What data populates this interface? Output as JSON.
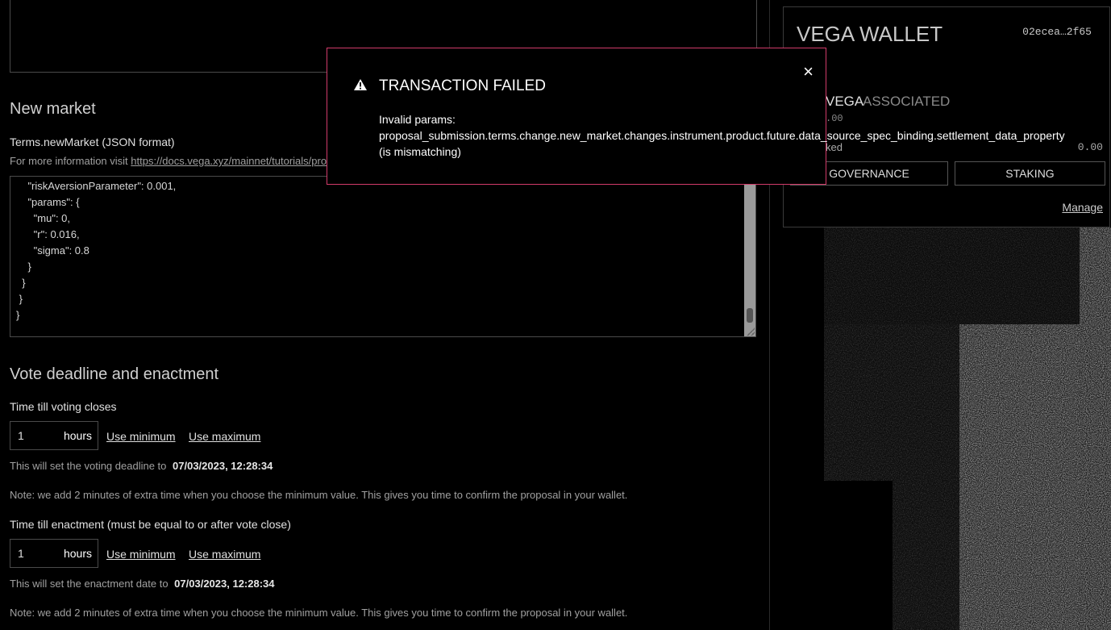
{
  "new_market": {
    "heading": "New market",
    "terms_label": "Terms.newMarket (JSON format)",
    "info_prefix": "For more information visit",
    "info_link": "https://docs.vega.xyz/mainnet/tutorials/pro",
    "json_lines": [
      "    \"riskAversionParameter\": 0.001,",
      "    \"params\": {",
      "      \"mu\": 0,",
      "      \"r\": 0.016,",
      "      \"sigma\": 0.8",
      "    }",
      "  }",
      " }",
      "}"
    ]
  },
  "vote": {
    "heading": "Vote deadline and enactment",
    "voting": {
      "label": "Time till voting closes",
      "value": "1",
      "unit": "hours",
      "use_min": "Use minimum",
      "use_max": "Use maximum",
      "deadline_text": "This will set the voting deadline to",
      "deadline_value": "07/03/2023, 12:28:34",
      "note": "Note: we add 2 minutes of extra time when you choose the minimum value. This gives you time to confirm the proposal in your wallet."
    },
    "enactment": {
      "label": "Time till enactment (must be equal to or after vote close)",
      "value": "1",
      "unit": "hours",
      "use_min": "Use minimum",
      "use_max": "Use maximum",
      "date_text": "This will set the enactment date to",
      "date_value": "07/03/2023, 12:28:34",
      "note": "Note: we add 2 minutes of extra time when you choose the minimum value. This gives you time to confirm the proposal in your wallet."
    }
  },
  "wallet": {
    "title": "VEGA WALLET",
    "key": "02ecea…2f65",
    "token": "VEGA",
    "associated": "ASSOCIATED",
    "associated_value": ".00",
    "locked_label": "ked",
    "locked_value": "0.00",
    "governance_btn": "GOVERNANCE",
    "staking_btn": "STAKING",
    "manage_link": "Manage"
  },
  "modal": {
    "title": "TRANSACTION FAILED",
    "close_glyph": "×",
    "line1": "Invalid params:",
    "line2": "proposal_submission.terms.change.new_market.changes.instrument.product.future.data_source_spec_binding.settlement_data_property",
    "line3": "(is mismatching)",
    "border_color": "#d13b6a"
  }
}
